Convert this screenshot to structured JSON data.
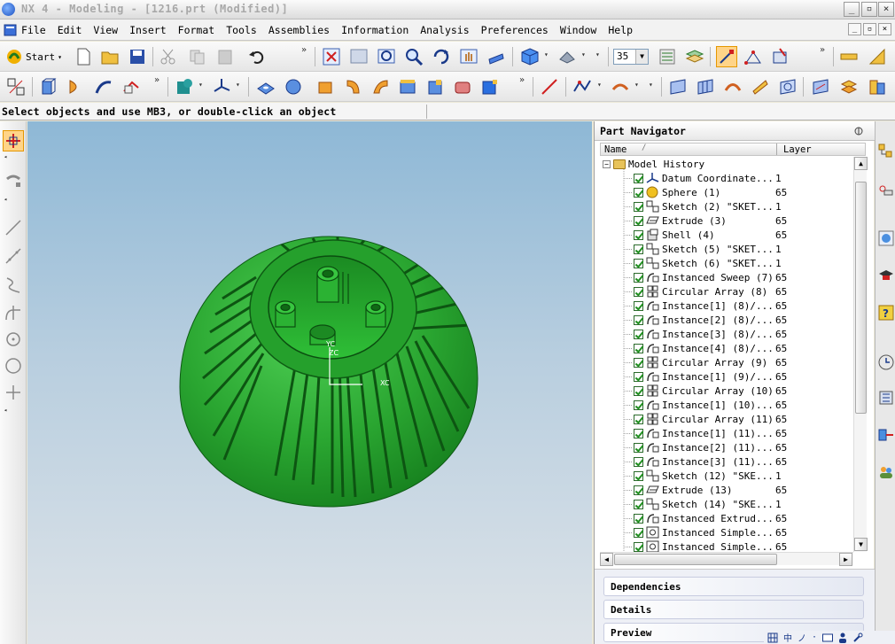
{
  "window": {
    "title": "NX 4 - Modeling - [1216.prt (Modified)]",
    "buttons": [
      "_",
      "▫",
      "×"
    ],
    "mdi_buttons": [
      "_",
      "▫",
      "×"
    ]
  },
  "menubar": {
    "items": [
      "File",
      "Edit",
      "View",
      "Insert",
      "Format",
      "Tools",
      "Assemblies",
      "Information",
      "Analysis",
      "Preferences",
      "Window",
      "Help"
    ]
  },
  "toolbar": {
    "start_label": "Start",
    "zoom_value": "35",
    "overflow": "»"
  },
  "cue_line": {
    "text": "Select objects and use MB3, or double-click an object"
  },
  "viewport": {
    "background_top": "#8eb8d6",
    "background_bottom": "#dde3e8",
    "model_color": "#2fa83a",
    "triad": {
      "yc": "YC",
      "zc": "ZC",
      "xc": "XC"
    }
  },
  "part_navigator": {
    "title": "Part Navigator",
    "columns": {
      "name": "Name",
      "sort": "/",
      "layer": "Layer"
    },
    "root": "Model History",
    "features": [
      {
        "name": "Datum Coordinate...",
        "layer": "1",
        "icon": "datum-csys-icon"
      },
      {
        "name": "Sphere (1)",
        "layer": "65",
        "icon": "sphere-icon"
      },
      {
        "name": "Sketch (2) \"SKET...",
        "layer": "1",
        "icon": "sketch-icon"
      },
      {
        "name": "Extrude (3)",
        "layer": "65",
        "icon": "extrude-icon"
      },
      {
        "name": "Shell (4)",
        "layer": "65",
        "icon": "shell-icon"
      },
      {
        "name": "Sketch (5) \"SKET...",
        "layer": "1",
        "icon": "sketch-icon"
      },
      {
        "name": "Sketch (6) \"SKET...",
        "layer": "1",
        "icon": "sketch-icon"
      },
      {
        "name": "Instanced Sweep (7)",
        "layer": "65",
        "icon": "instance-icon"
      },
      {
        "name": "Circular Array (8)",
        "layer": "65",
        "icon": "array-icon"
      },
      {
        "name": "Instance[1] (8)/...",
        "layer": "65",
        "icon": "instance-icon"
      },
      {
        "name": "Instance[2] (8)/...",
        "layer": "65",
        "icon": "instance-icon"
      },
      {
        "name": "Instance[3] (8)/...",
        "layer": "65",
        "icon": "instance-icon"
      },
      {
        "name": "Instance[4] (8)/...",
        "layer": "65",
        "icon": "instance-icon"
      },
      {
        "name": "Circular Array (9)",
        "layer": "65",
        "icon": "array-icon"
      },
      {
        "name": "Instance[1] (9)/...",
        "layer": "65",
        "icon": "instance-icon"
      },
      {
        "name": "Circular Array (10)",
        "layer": "65",
        "icon": "array-icon"
      },
      {
        "name": "Instance[1] (10)...",
        "layer": "65",
        "icon": "instance-icon"
      },
      {
        "name": "Circular Array (11)",
        "layer": "65",
        "icon": "array-icon"
      },
      {
        "name": "Instance[1] (11)...",
        "layer": "65",
        "icon": "instance-icon"
      },
      {
        "name": "Instance[2] (11)...",
        "layer": "65",
        "icon": "instance-icon"
      },
      {
        "name": "Instance[3] (11)...",
        "layer": "65",
        "icon": "instance-icon"
      },
      {
        "name": "Sketch (12) \"SKE...",
        "layer": "1",
        "icon": "sketch-icon"
      },
      {
        "name": "Extrude (13)",
        "layer": "65",
        "icon": "extrude-icon"
      },
      {
        "name": "Sketch (14) \"SKE...",
        "layer": "1",
        "icon": "sketch-icon"
      },
      {
        "name": "Instanced Extrud...",
        "layer": "65",
        "icon": "instance-icon"
      },
      {
        "name": "Instanced Simple...",
        "layer": "65",
        "icon": "hole-icon"
      },
      {
        "name": "Instanced Simple...",
        "layer": "65",
        "icon": "hole-icon"
      }
    ],
    "sections": {
      "dependencies": "Dependencies",
      "details": "Details",
      "preview": "Preview"
    }
  },
  "ime": {
    "chars": [
      "中",
      "ノ",
      "·"
    ]
  }
}
